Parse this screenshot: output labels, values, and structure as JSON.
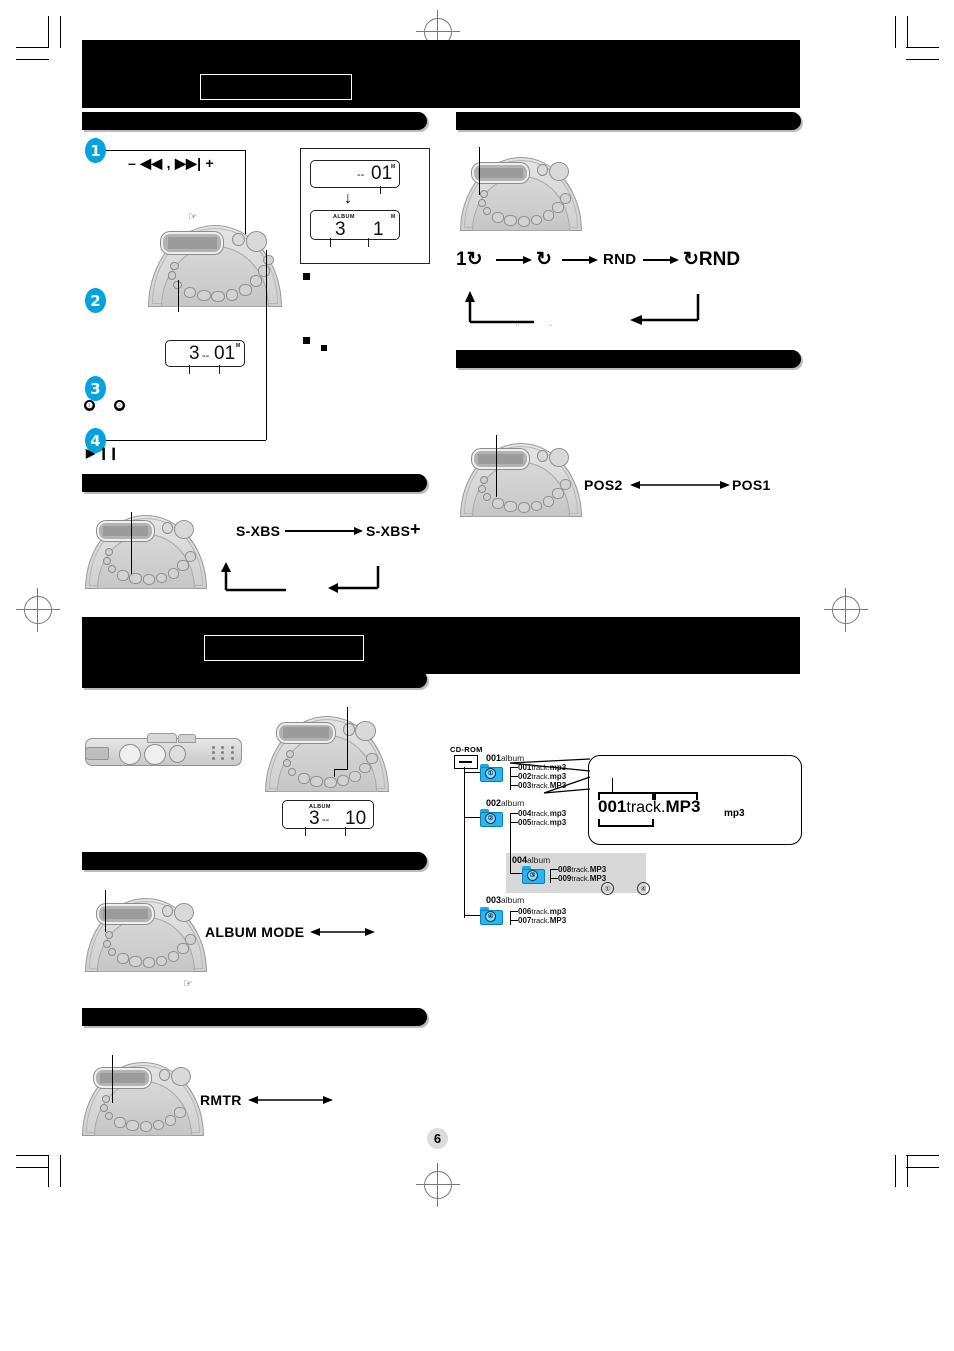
{
  "page": {
    "number": "6"
  },
  "colors": {
    "accent": "#00a3e0",
    "folder": "#29b6f0",
    "banner": "#000000"
  },
  "sections": {
    "main_banner_1": {
      "title": "",
      "subtitle_box": ""
    },
    "main_banner_2": {
      "title": "",
      "subtitle_box": ""
    },
    "bar_skip": {
      "title": ""
    },
    "bar_repeat": {
      "title": ""
    },
    "bar_pos": {
      "title": ""
    },
    "bar_sxbs": {
      "title": ""
    },
    "bar_mp3_play": {
      "title": ""
    },
    "bar_album_mode": {
      "title": ""
    },
    "bar_rmtr": {
      "title": ""
    }
  },
  "skip_section": {
    "steps": [
      {
        "num": "1",
        "control_label": "–  ◀◀ ,  ▶▶|  +"
      },
      {
        "num": "2",
        "control_label": ""
      },
      {
        "num": "3",
        "control_label": ""
      },
      {
        "num": "4",
        "control_label": "▶ Ⅱ"
      }
    ],
    "bullets": [
      "❶",
      "❷"
    ],
    "play_pause_glyph": "▶ ❙❙",
    "lcd_step2": {
      "album": "3",
      "dashes": "--",
      "track": "01",
      "m_tag": "M"
    },
    "callout_lcds": [
      {
        "album": "",
        "dashes": "--",
        "track": "01",
        "m_tag": "M",
        "album_label": ""
      },
      {
        "album": "3",
        "dashes": "",
        "track": "1",
        "m_tag": "M",
        "album_label": "ALBUM"
      }
    ],
    "arrow_glyph": "↓"
  },
  "repeat_section": {
    "sequence": [
      "1↻",
      "↻",
      "RND",
      "↻RND"
    ],
    "arrow": "→",
    "small_marks": [
      "··",
      "··"
    ]
  },
  "pos_section": {
    "left_label": "POS2",
    "right_label": "POS1",
    "arrow": "⟷"
  },
  "sxbs_section": {
    "left_label": "S-XBS",
    "right_label": "S-XBS",
    "plus_glyph": "+",
    "arrow": "→"
  },
  "mp3_play_section": {
    "lcd": {
      "album_label": "ALBUM",
      "album": "3",
      "dashes": "--",
      "track": "10",
      "m_tag": ""
    }
  },
  "album_mode_section": {
    "label": "ALBUM MODE",
    "arrow": "⟷",
    "hand_glyph": "☞"
  },
  "rmtr_section": {
    "label": "RMTR",
    "arrow": "⟷"
  },
  "tree_diagram": {
    "root_label": "CD-ROM",
    "albums": [
      {
        "name_num": "001",
        "name_word": "album",
        "folder_num": "①",
        "tracks": [
          {
            "num": "001",
            "word": "track.",
            "ext": "mp3"
          },
          {
            "num": "002",
            "word": "track.",
            "ext": "mp3"
          },
          {
            "num": "003",
            "word": "track.",
            "ext": "MP3"
          }
        ]
      },
      {
        "name_num": "002",
        "name_word": "album",
        "folder_num": "②",
        "tracks": [
          {
            "num": "004",
            "word": "track.",
            "ext": "mp3"
          },
          {
            "num": "005",
            "word": "track.",
            "ext": "mp3"
          }
        ]
      },
      {
        "name_num": "004",
        "name_word": "album",
        "folder_num": "③",
        "nested": true,
        "tracks": [
          {
            "num": "008",
            "word": "track.",
            "ext": "MP3"
          },
          {
            "num": "009",
            "word": "track.",
            "ext": "MP3"
          }
        ]
      },
      {
        "name_num": "003",
        "name_word": "album",
        "folder_num": "④",
        "tracks": [
          {
            "num": "006",
            "word": "track.",
            "ext": "mp3"
          },
          {
            "num": "007",
            "word": "track.",
            "ext": "MP3"
          }
        ]
      }
    ],
    "callout": {
      "file_num": "001",
      "file_word": "track.",
      "file_ext": "MP3",
      "note": "mp3"
    },
    "refs": [
      "①",
      "④"
    ]
  }
}
